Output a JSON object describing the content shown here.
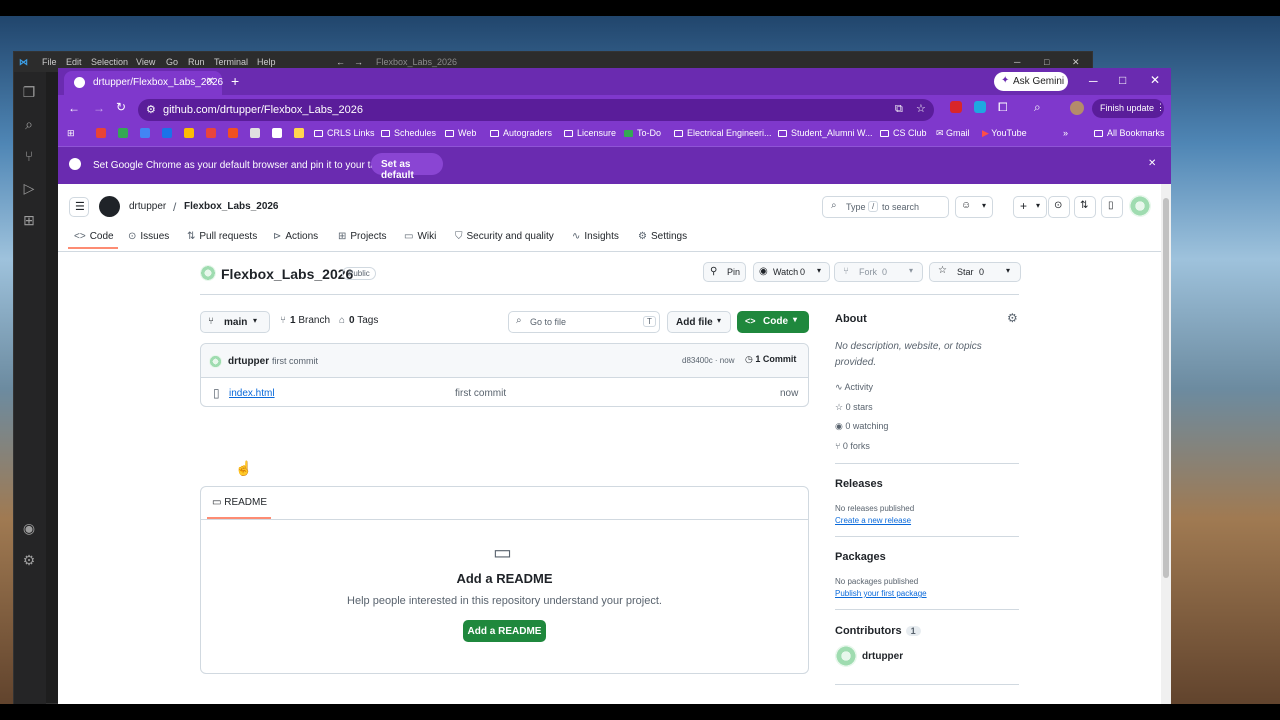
{
  "vscode": {
    "menu": [
      "File",
      "Edit",
      "Selection",
      "View",
      "Go",
      "Run",
      "Terminal",
      "Help"
    ],
    "title": "Flexbox_Labs_2026"
  },
  "chrome": {
    "tab_title": "drtupper/Flexbox_Labs_2026",
    "url": "github.com/drtupper/Flexbox_Labs_2026",
    "ask_gemini": "Ask Gemini",
    "finish_update": "Finish update",
    "bookmarks": [
      "CRLS Links",
      "Schedules",
      "Web",
      "Autograders",
      "Licensure",
      "To-Do",
      "Electrical Engineeri...",
      "Student_Alumni W...",
      "CS Club",
      "Gmail",
      "YouTube"
    ],
    "all_bookmarks": "All Bookmarks",
    "banner_text": "Set Google Chrome as your default browser and pin it to your taskbar",
    "banner_button": "Set as default"
  },
  "github": {
    "owner": "drtupper",
    "repo": "Flexbox_Labs_2026",
    "search_type": "Type",
    "search_key": "/",
    "search_rest": "to search",
    "nav": [
      "Code",
      "Issues",
      "Pull requests",
      "Actions",
      "Projects",
      "Wiki",
      "Security and quality",
      "Insights",
      "Settings"
    ],
    "visibility": "Public",
    "pin": "Pin",
    "watch": "Watch",
    "watch_count": "0",
    "fork": "Fork",
    "fork_count": "0",
    "star": "Star",
    "star_count": "0",
    "branch": "main",
    "branches_count": "1",
    "branches_label": "Branch",
    "tags_count": "0",
    "tags_label": "Tags",
    "goto_placeholder": "Go to file",
    "goto_key": "T",
    "add_file": "Add file",
    "code_button": "Code",
    "commit_author": "drtupper",
    "commit_msg": "first commit",
    "commit_hash": "d83400c · now",
    "commit_count": "1 Commit",
    "files": [
      {
        "name": "index.html",
        "message": "first commit",
        "time": "now"
      }
    ],
    "readme_tab": "README",
    "readme_title": "Add a README",
    "readme_desc": "Help people interested in this repository understand your project.",
    "readme_button": "Add a README",
    "about": {
      "title": "About",
      "desc": "No description, website, or topics provided.",
      "activity": "Activity",
      "stars": "0 stars",
      "watching": "0 watching",
      "forks": "0 forks"
    },
    "releases": {
      "title": "Releases",
      "none": "No releases published",
      "link": "Create a new release"
    },
    "packages": {
      "title": "Packages",
      "none": "No packages published",
      "link": "Publish your first package"
    },
    "contributors": {
      "title": "Contributors",
      "count": "1",
      "name": "drtupper"
    }
  }
}
